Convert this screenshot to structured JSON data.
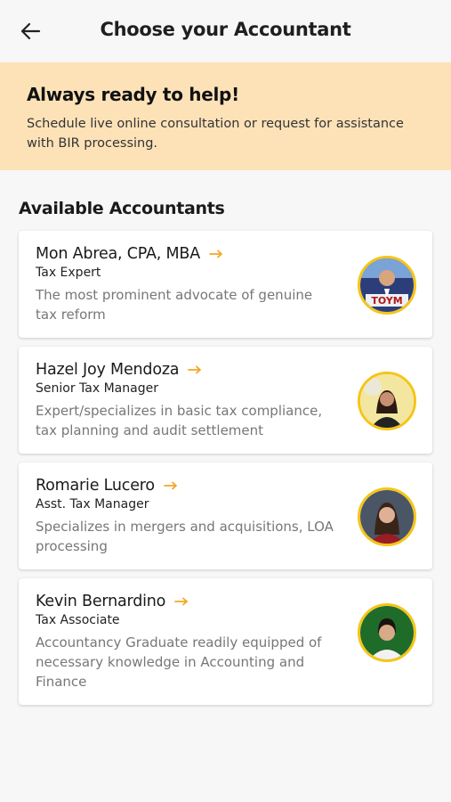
{
  "header": {
    "title": "Choose your Accountant",
    "back_icon": "arrow-left-icon"
  },
  "banner": {
    "title": "Always ready to help!",
    "text": "Schedule live online consultation or request for assistance with BIR processing."
  },
  "section": {
    "title": "Available Accountants"
  },
  "colors": {
    "banner_bg": "#fde2b8",
    "accent": "#f5a623",
    "avatar_border": "#f5c518"
  },
  "accountants": [
    {
      "name": "Mon Abrea, CPA, MBA",
      "role": "Tax Expert",
      "description": "The most prominent advocate of genuine tax reform",
      "avatar_logo": "TOYM"
    },
    {
      "name": "Hazel Joy Mendoza",
      "role": "Senior Tax Manager",
      "description": "Expert/specializes in basic tax compliance, tax planning and audit settlement"
    },
    {
      "name": "Romarie Lucero",
      "role": "Asst. Tax Manager",
      "description": "Specializes in mergers and acquisitions, LOA processing"
    },
    {
      "name": "Kevin Bernardino",
      "role": "Tax Associate",
      "description": "Accountancy Graduate readily equipped of necessary knowledge in Accounting and Finance"
    }
  ]
}
